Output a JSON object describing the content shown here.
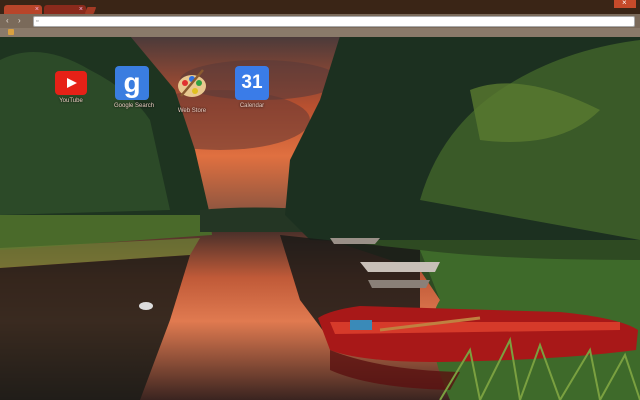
{
  "window": {
    "tabs": [
      {
        "label": "",
        "close": "×"
      },
      {
        "label": "",
        "close": "×"
      }
    ],
    "close_glyph": "×"
  },
  "toolbar": {
    "back_glyph": "‹",
    "forward_glyph": "›",
    "omnibox_value": "",
    "omnibox_icon": "page-icon"
  },
  "apps": [
    {
      "name": "YouTube",
      "icon": "youtube-icon"
    },
    {
      "name": "Google Search",
      "icon": "google-icon",
      "glyph": "g"
    },
    {
      "name": "Web Store",
      "icon": "palette-icon"
    },
    {
      "name": "Calendar",
      "icon": "calendar-icon",
      "glyph": "31"
    }
  ],
  "colors": {
    "youtube": "#e62117",
    "google": "#3a7de0",
    "calendar": "#3a7ce8",
    "tab_active": "#b8452a"
  }
}
